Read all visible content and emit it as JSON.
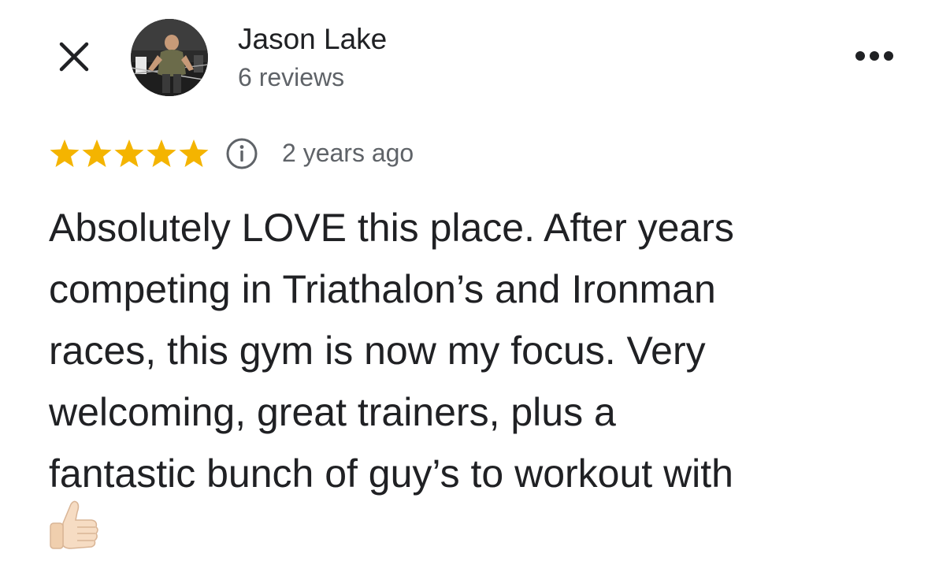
{
  "header": {
    "close_icon": "close-icon",
    "reviewer_name": "Jason Lake",
    "review_count": "6 reviews",
    "more_icon": "more-horiz-icon"
  },
  "review": {
    "rating": 5,
    "rating_max": 5,
    "star_color": "#F4B400",
    "info_icon": "info-icon",
    "date": "2 years ago",
    "lines": [
      "Absolutely LOVE this place. After years",
      "competing in Triathalon’s and Ironman",
      "races, this gym is now my focus. Very",
      "welcoming, great trainers, plus a",
      "fantastic bunch of guy’s to workout with"
    ],
    "trailing_emoji": "thumbs-up-emoji"
  }
}
